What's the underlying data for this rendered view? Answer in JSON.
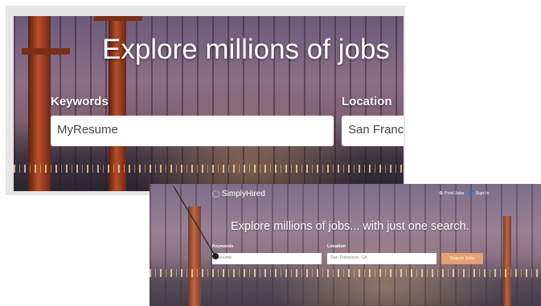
{
  "zoom": {
    "headline": "Explore millions of jobs",
    "keywords_label": "Keywords",
    "keywords_value": "MyResume",
    "location_label": "Location",
    "location_value": "San Franc"
  },
  "page": {
    "logo_text": "SimplyHired",
    "nav": {
      "post_jobs": "Post Jobs",
      "sign_in": "Sign In"
    },
    "headline": "Explore millions of jobs... with just one search.",
    "keywords_label": "Keywords",
    "keywords_value": "Resume",
    "location_label": "Location",
    "location_value": "San Francisco, CA",
    "search_button": "Search Jobs"
  },
  "colors": {
    "accent_button": "#e8a070",
    "bridge": "#b8502a"
  },
  "icons": {
    "logo": "simplyhired-logo-icon",
    "post_jobs": "plus-icon",
    "sign_in": "user-icon"
  }
}
